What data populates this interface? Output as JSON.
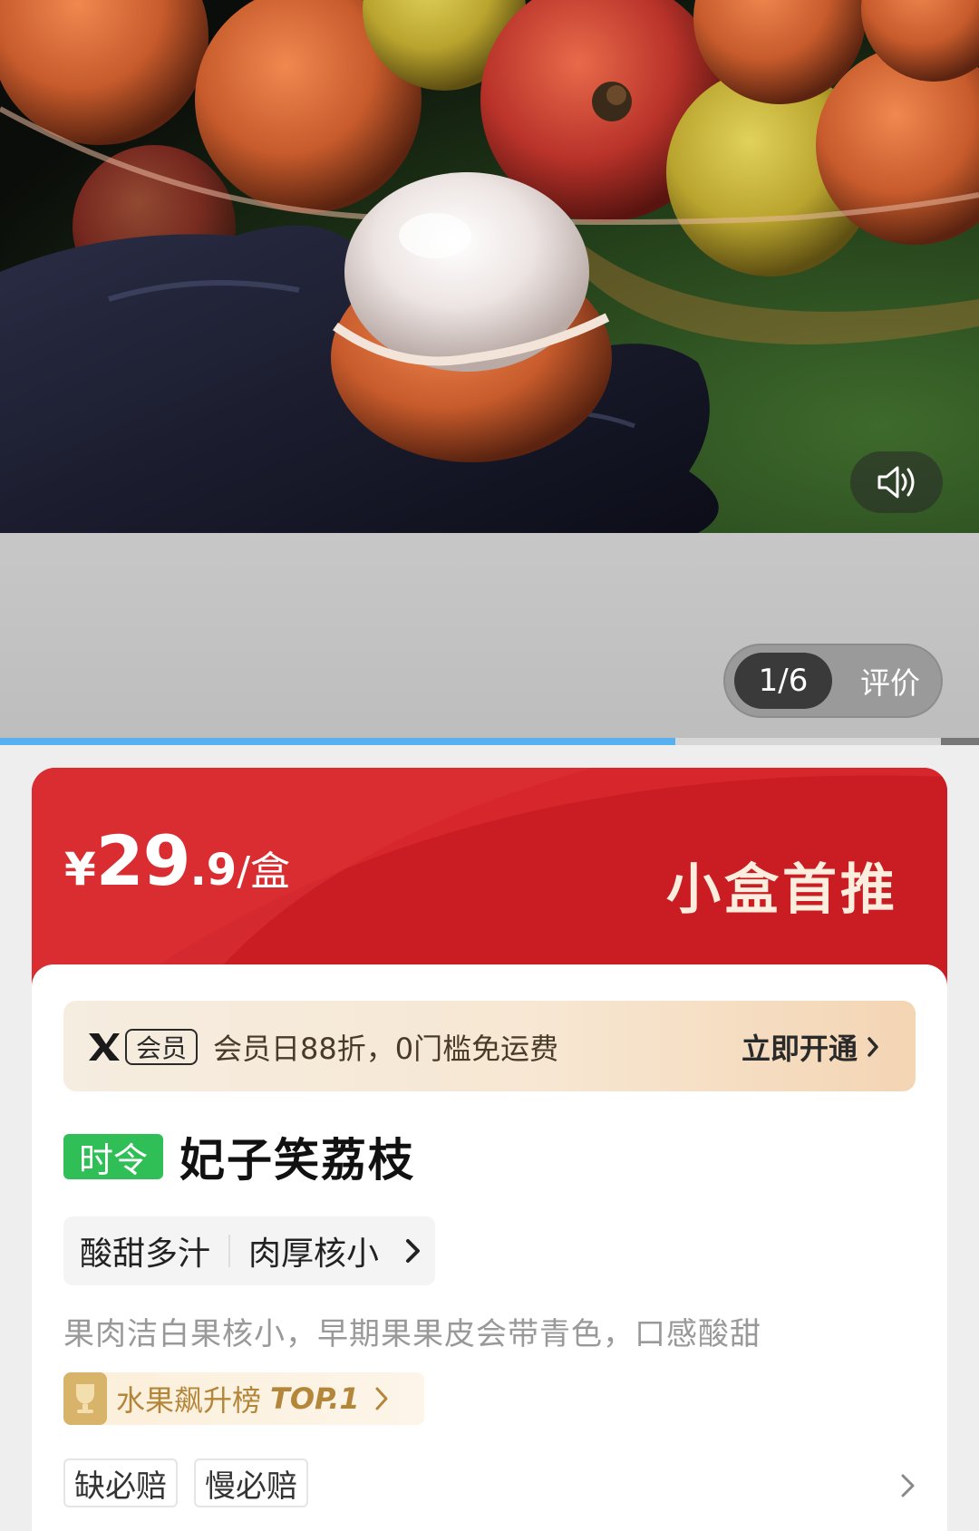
{
  "media": {
    "pager_count": "1/6",
    "review_label": "评价",
    "progress": 0.69,
    "sound_icon": "speaker-icon"
  },
  "price": {
    "currency": "¥",
    "integer": "29",
    "decimal": ".9",
    "unit": "/盒"
  },
  "promo_title": "小盒首推",
  "member": {
    "badge": "会员",
    "text": "会员日88折，0门槛免运费",
    "cta": "立即开通"
  },
  "product": {
    "tag": "时令",
    "name": "妃子笑荔枝",
    "features": [
      "酸甜多汁",
      "肉厚核小"
    ],
    "description": "果肉洁白果核小，早期果果皮会带青色，口感酸甜"
  },
  "rank": {
    "label": "水果飙升榜",
    "top": "TOP.1"
  },
  "guarantees": [
    "缺必赔",
    "慢必赔"
  ],
  "colors": {
    "banner_red": "#d7262c",
    "tag_green": "#2fbf56",
    "progress_blue": "#58b0ee"
  }
}
